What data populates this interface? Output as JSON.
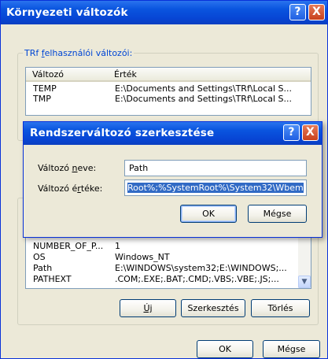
{
  "window": {
    "title": "Környezeti változók",
    "help_icon": "?",
    "close_icon": "X"
  },
  "user_group": {
    "label": "TRf felhasználói változói:",
    "columns": [
      "Változó",
      "Érték"
    ],
    "rows": [
      {
        "name": "TEMP",
        "value": "E:\\Documents and Settings\\TRf\\Local S..."
      },
      {
        "name": "TMP",
        "value": "E:\\Documents and Settings\\TRf\\Local S..."
      }
    ]
  },
  "system_group": {
    "rows": [
      {
        "name": "NUMBER_OF_P...",
        "value": "1"
      },
      {
        "name": "OS",
        "value": "Windows_NT"
      },
      {
        "name": "Path",
        "value": "E:\\WINDOWS\\system32;E:\\WINDOWS;..."
      },
      {
        "name": "PATHEXT",
        "value": ".COM;.EXE;.BAT;.CMD;.VBS;.VBE;.JS;..."
      }
    ],
    "buttons": {
      "new": "Új",
      "edit": "Szerkesztés",
      "delete": "Törlés"
    }
  },
  "bottom_buttons": {
    "ok": "OK",
    "cancel": "Mégse"
  },
  "edit_dialog": {
    "title": "Rendszerváltozó szerkesztése",
    "name_label": "Változó neve:",
    "name_value": "Path",
    "value_label": "Változó értéke:",
    "value_value": "Root%;%SystemRoot%\\System32\\Wbem",
    "ok": "OK",
    "cancel": "Mégse"
  },
  "colors": {
    "titlebar": "#0a55df",
    "group_label": "#0046d5",
    "selection": "#316ac5"
  }
}
